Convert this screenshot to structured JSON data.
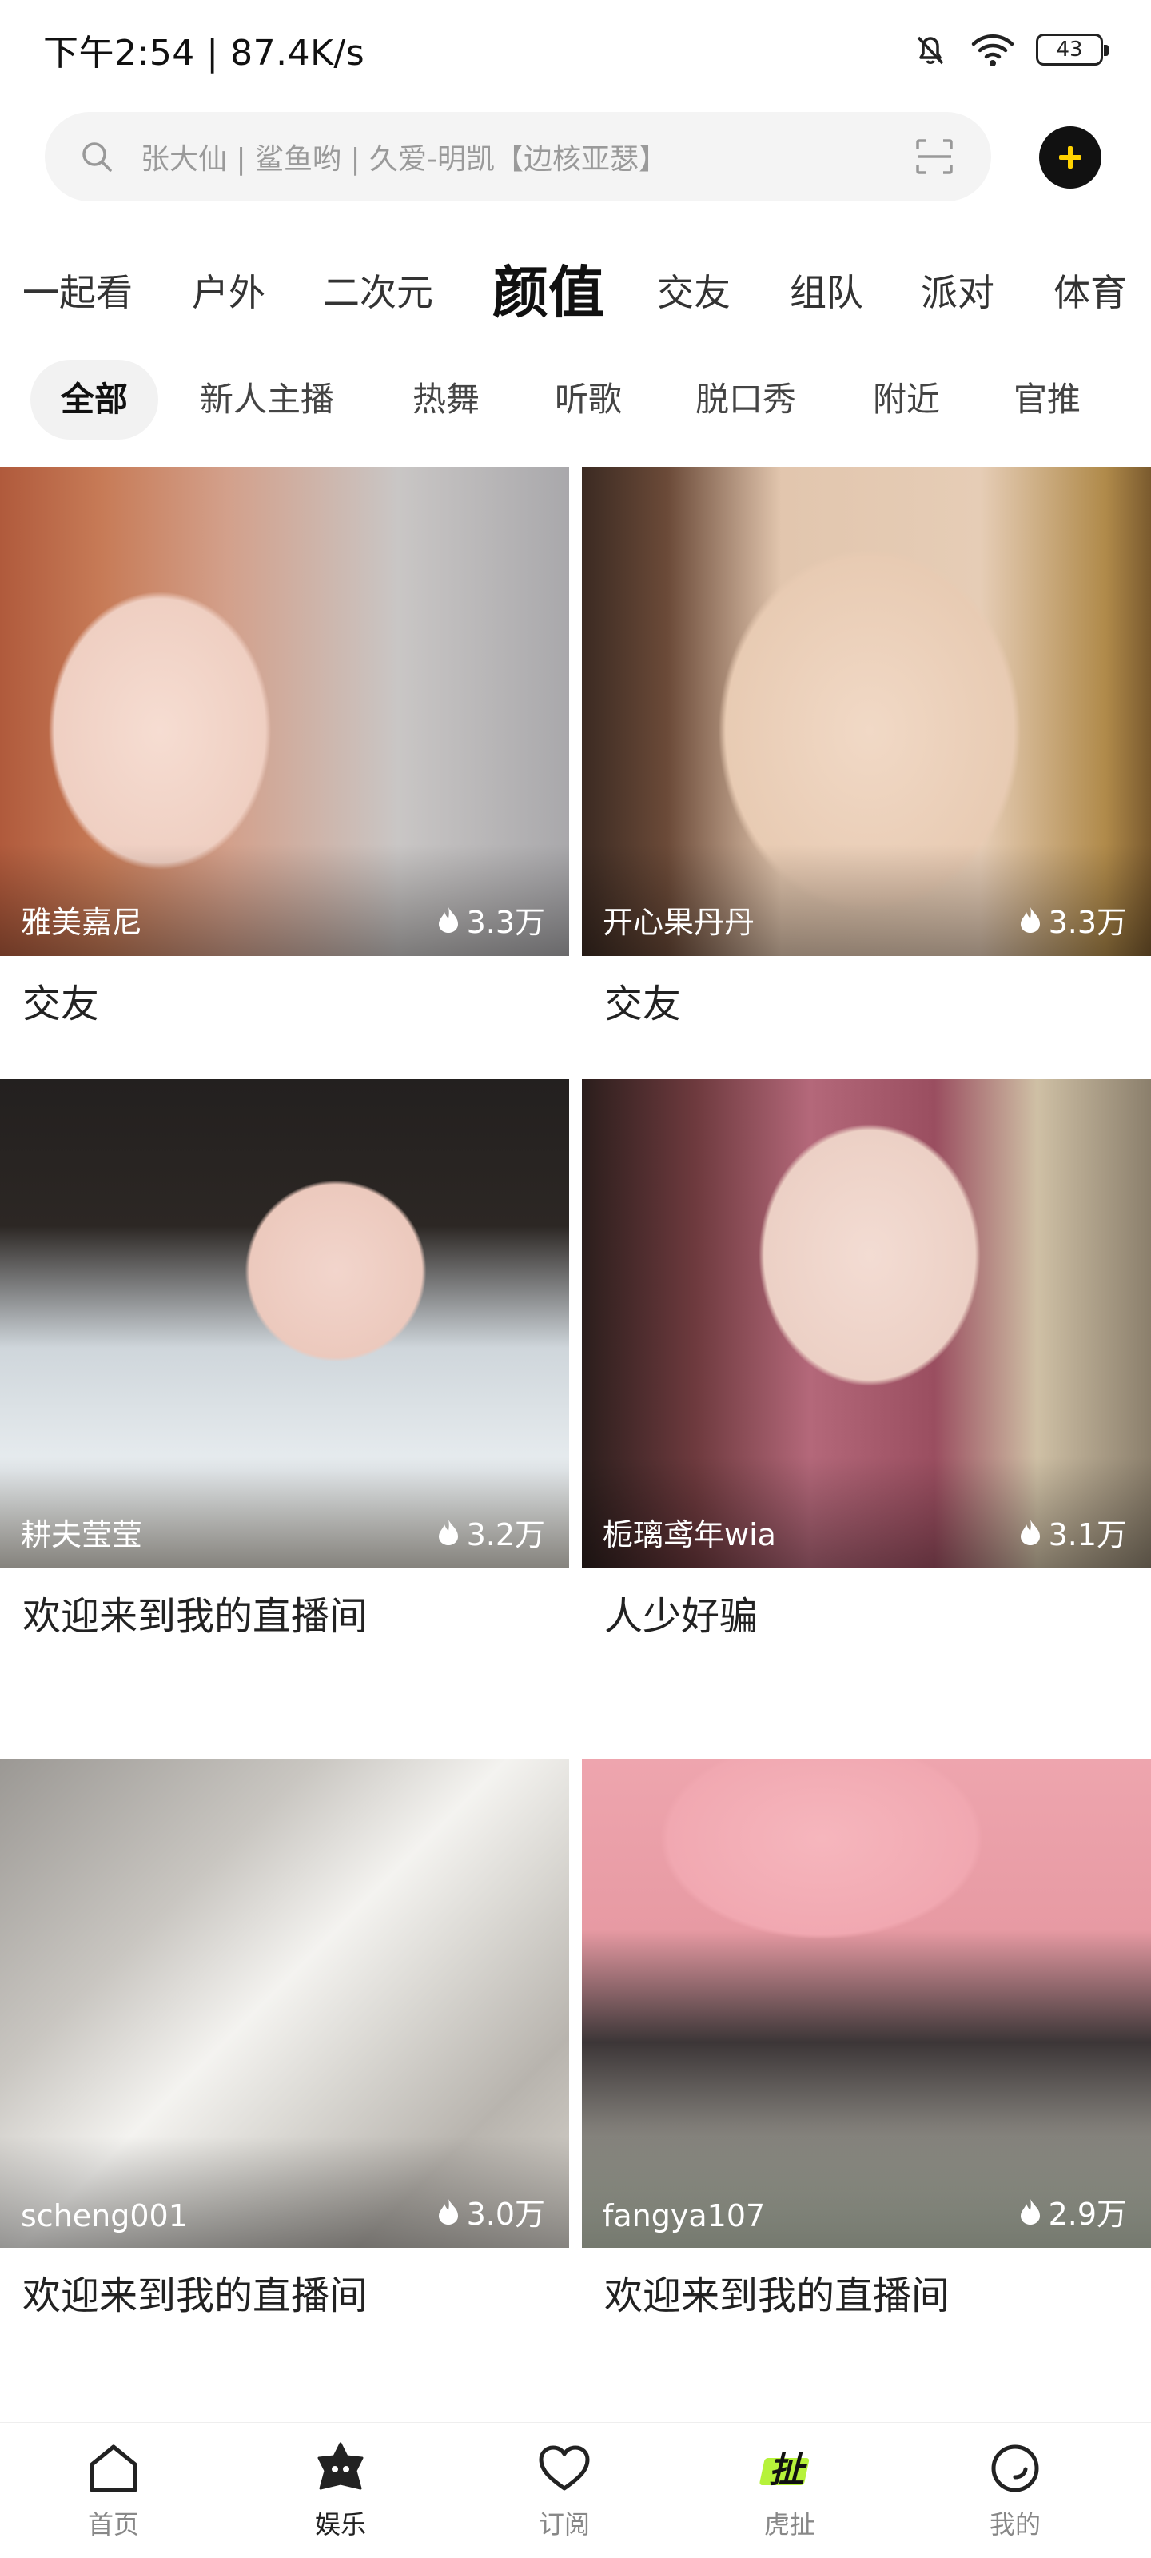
{
  "status_bar": {
    "time": "下午2:54 | 87.4K/s",
    "battery": "43"
  },
  "search": {
    "placeholder": "张大仙 | 鲨鱼哟 | 久爱-明凯【边核亚瑟】"
  },
  "category_tabs": [
    "一起看",
    "户外",
    "二次元",
    "颜值",
    "交友",
    "组队",
    "派对",
    "体育"
  ],
  "active_category": "颜值",
  "sub_tabs": [
    "全部",
    "新人主播",
    "热舞",
    "听歌",
    "脱口秀",
    "附近",
    "官推"
  ],
  "active_sub_tab": "全部",
  "rooms": [
    {
      "streamer": "雅美嘉尼",
      "heat": "3.3万",
      "title": "交友"
    },
    {
      "streamer": "开心果丹丹",
      "heat": "3.3万",
      "title": "交友"
    },
    {
      "streamer": "耕夫莹莹",
      "heat": "3.2万",
      "title": "欢迎来到我的直播间"
    },
    {
      "streamer": "栀璃鸢年wia",
      "heat": "3.1万",
      "title": "人少好骗"
    },
    {
      "streamer": "scheng001",
      "heat": "3.0万",
      "title": "欢迎来到我的直播间"
    },
    {
      "streamer": "fangya107",
      "heat": "2.9万",
      "title": "欢迎来到我的直播间"
    }
  ],
  "bottom_nav": [
    {
      "label": "首页",
      "icon": "home-icon"
    },
    {
      "label": "娱乐",
      "icon": "entertainment-icon"
    },
    {
      "label": "订阅",
      "icon": "heart-icon"
    },
    {
      "label": "虎扯",
      "icon": "huche-icon"
    },
    {
      "label": "我的",
      "icon": "profile-icon"
    }
  ],
  "active_nav": "娱乐",
  "colors": {
    "accent_yellow": "#ffd200",
    "add_button_bg": "#111111",
    "search_bg": "#f4f4f4"
  }
}
